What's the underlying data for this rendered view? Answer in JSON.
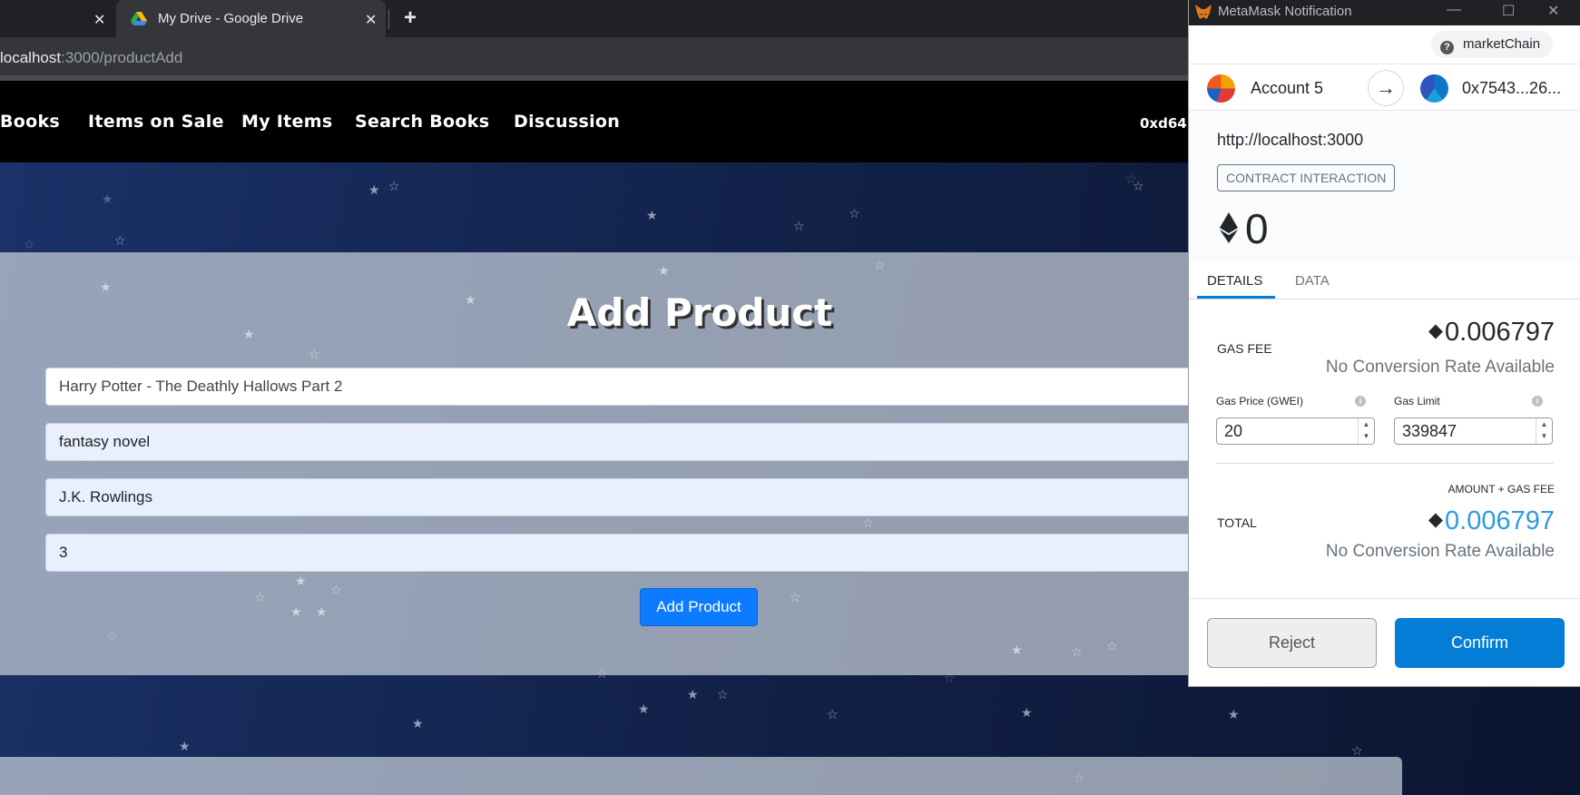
{
  "browser": {
    "prev_tab_close": "✕",
    "active_tab_title": "My Drive - Google Drive",
    "active_tab_close": "✕",
    "new_tab": "+",
    "url_host": "localhost",
    "url_path": ":3000/productAdd"
  },
  "nav": {
    "items": [
      "Books",
      "Items on Sale",
      "My Items",
      "Search Books",
      "Discussion"
    ],
    "account_short": "0xd64"
  },
  "form": {
    "title": "Add Product",
    "fields": [
      {
        "value": "Harry Potter - The Deathly Hallows Part 2"
      },
      {
        "value": "fantasy novel"
      },
      {
        "value": "J.K. Rowlings"
      },
      {
        "value": "3"
      }
    ],
    "submit_label": "Add Product"
  },
  "metamask": {
    "window_title": "MetaMask Notification",
    "network": "marketChain",
    "from_account": "Account 5",
    "to_address": "0x7543...26...",
    "origin": "http://localhost:3000",
    "action_badge": "CONTRACT INTERACTION",
    "amount": "0",
    "tabs": [
      "DETAILS",
      "DATA"
    ],
    "gas_fee_label": "GAS FEE",
    "gas_fee_value": "0.006797",
    "no_conversion": "No Conversion Rate Available",
    "gas_price_label": "Gas Price (GWEI)",
    "gas_price_value": "20",
    "gas_limit_label": "Gas Limit",
    "gas_limit_value": "339847",
    "amount_plus_gas_label": "AMOUNT + GAS FEE",
    "total_label": "TOTAL",
    "total_value": "0.006797",
    "reject_label": "Reject",
    "confirm_label": "Confirm",
    "colors": {
      "primary": "#037dd6",
      "total_value": "#2f9ae0"
    }
  }
}
